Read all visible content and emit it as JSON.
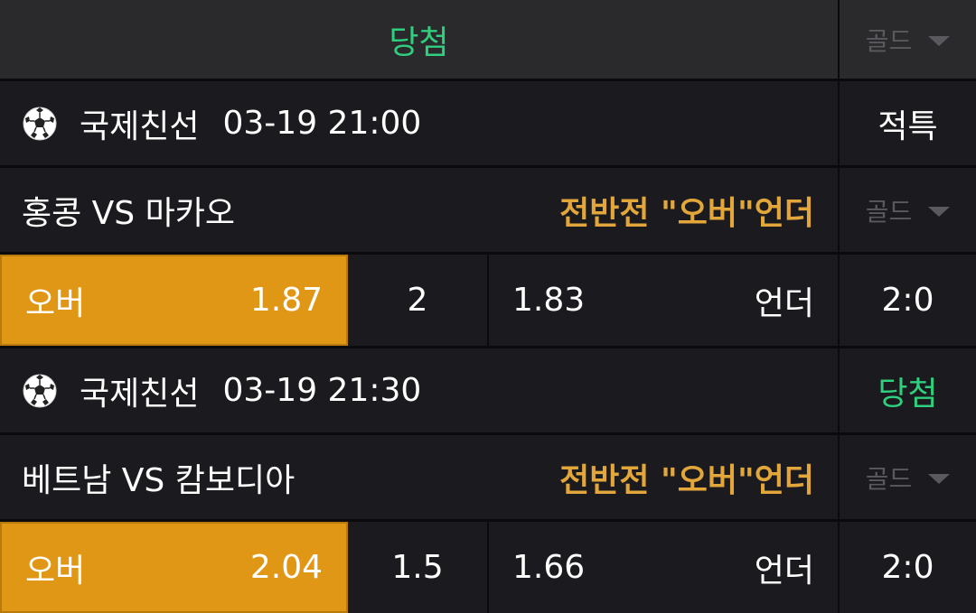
{
  "header": {
    "status": "당첨",
    "dropdown_label": "골드"
  },
  "matches": [
    {
      "league": "국제친선",
      "datetime": "03-19 21:00",
      "status": "적특",
      "teams": "홍콩 VS 마카오",
      "market": "전반전 \"오버\"언더",
      "dropdown_label": "골드",
      "over_label": "오버",
      "over_odds": "1.87",
      "line": "2",
      "under_odds": "1.83",
      "under_label": "언더",
      "score": "2:0"
    },
    {
      "league": "국제친선",
      "datetime": "03-19 21:30",
      "status": "당첨",
      "teams": "베트남 VS 캄보디아",
      "market": "전반전 \"오버\"언더",
      "dropdown_label": "골드",
      "over_label": "오버",
      "over_odds": "2.04",
      "line": "1.5",
      "under_odds": "1.66",
      "under_label": "언더",
      "score": "2:0"
    }
  ],
  "colors": {
    "background": "#1b1b1f",
    "win_green": "#2fcf7e",
    "market_gold": "#e3a63a",
    "selected_orange": "#e09716",
    "muted_grey": "#5a5a5e"
  }
}
